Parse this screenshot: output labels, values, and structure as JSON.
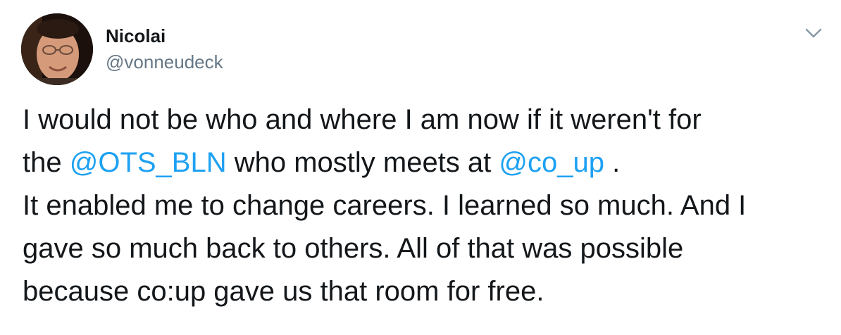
{
  "author": {
    "name": "Nicolai",
    "handle": "@vonneudeck"
  },
  "tweet": {
    "line1": "I would not be who and where I am now if it weren't for",
    "line2_pre": "the ",
    "mention1": "@OTS_BLN",
    "line2_mid": " who mostly meets at ",
    "mention2": "@co_up",
    "line2_post": " .",
    "line3": "It enabled me to change careers. I learned so much. And I",
    "line4": "gave so much back to others. All of that was possible",
    "line5": "because co:up gave us that room for free."
  },
  "icons": {
    "more": "chevron-down-icon"
  },
  "colors": {
    "text": "#14171a",
    "secondary": "#657786",
    "link": "#1da1f2",
    "background": "#ffffff"
  }
}
